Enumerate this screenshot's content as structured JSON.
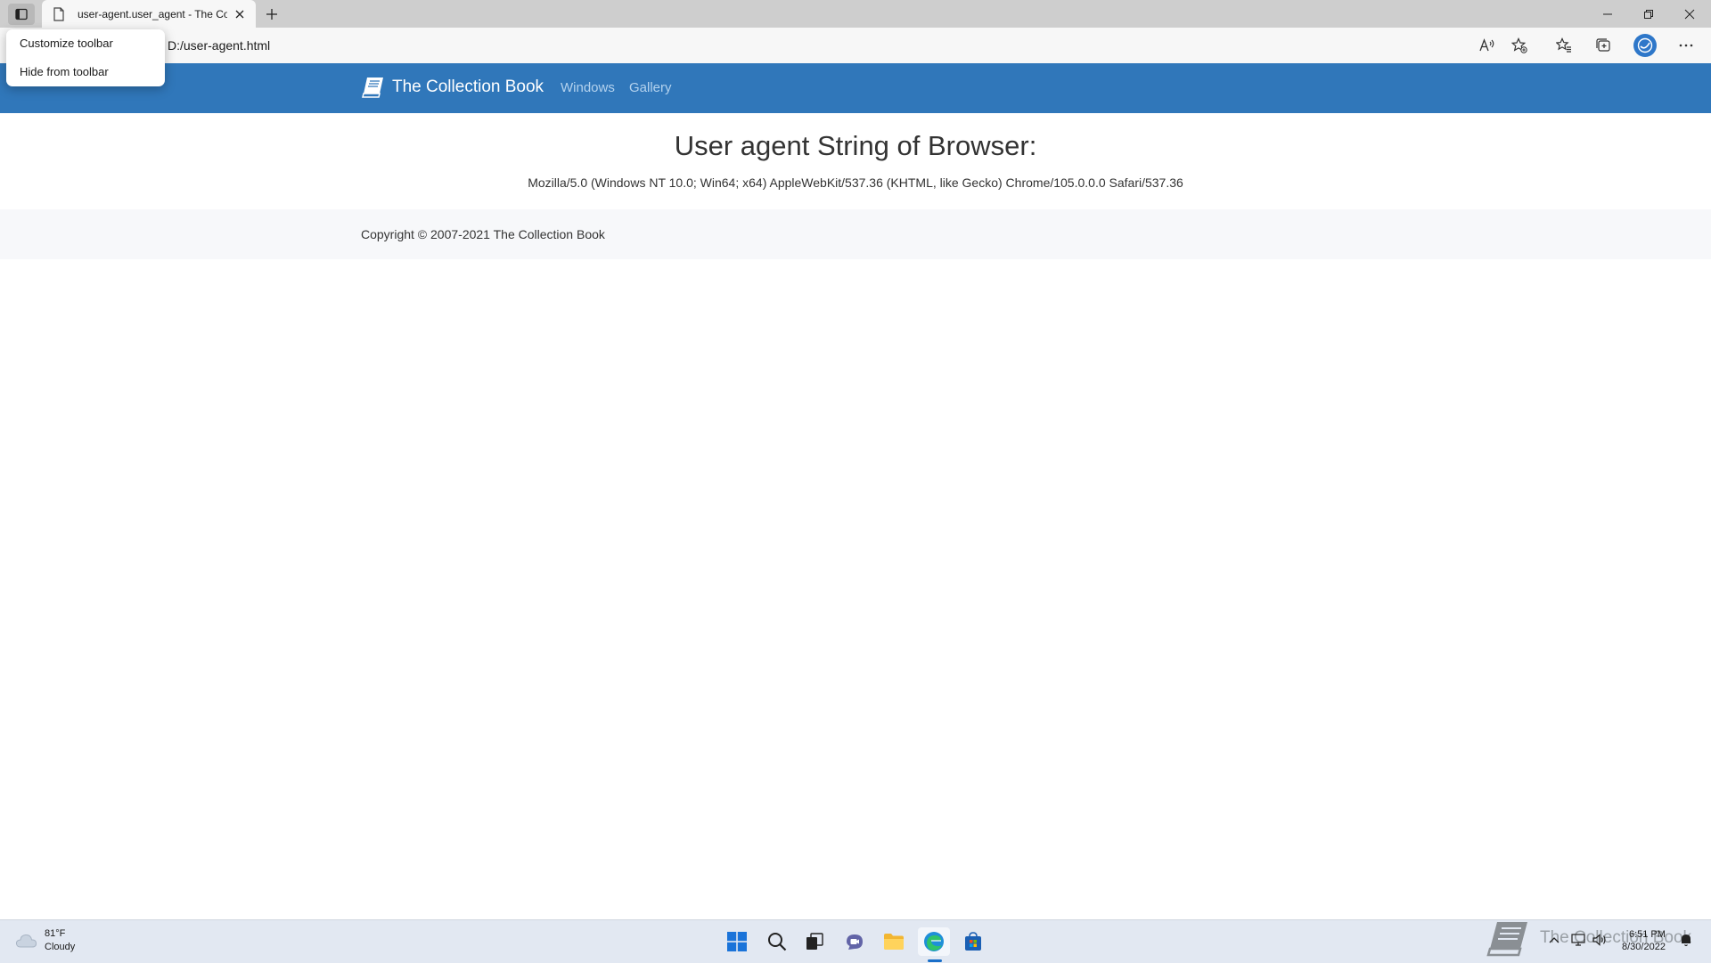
{
  "browser": {
    "tab_title": "user-agent.user_agent - The Col",
    "address": "D:/user-agent.html"
  },
  "context_menu": {
    "items": [
      {
        "label": "Customize toolbar"
      },
      {
        "label": "Hide from toolbar"
      }
    ]
  },
  "navbar": {
    "brand": "The Collection Book",
    "links": [
      {
        "label": "Windows"
      },
      {
        "label": "Gallery"
      }
    ]
  },
  "content": {
    "heading": "User agent String of Browser:",
    "user_agent": "Mozilla/5.0 (Windows NT 10.0; Win64; x64) AppleWebKit/537.36 (KHTML, like Gecko) Chrome/105.0.0.0 Safari/537.36"
  },
  "footer": {
    "copyright": "Copyright © 2007-2021 The Collection Book"
  },
  "taskbar": {
    "weather_temp": "81°F",
    "weather_cond": "Cloudy",
    "watermark": "The Collection Book",
    "time": "6:51 PM",
    "date": "8/30/2022"
  },
  "colors": {
    "navbar": "#3077ba",
    "nav_link": "#b3d2ee",
    "profile": "#2e77c9"
  },
  "icons": {
    "tab_actions": "tab-actions-icon",
    "favicon": "page-icon",
    "close": "close-icon",
    "new_tab": "plus-icon",
    "read_aloud": "read-aloud-icon",
    "add_favorite": "add-favorite-icon",
    "favorites": "favorites-icon",
    "collections": "collections-icon",
    "profile": "profile-icon",
    "more": "more-icon",
    "brand": "book-icon"
  }
}
